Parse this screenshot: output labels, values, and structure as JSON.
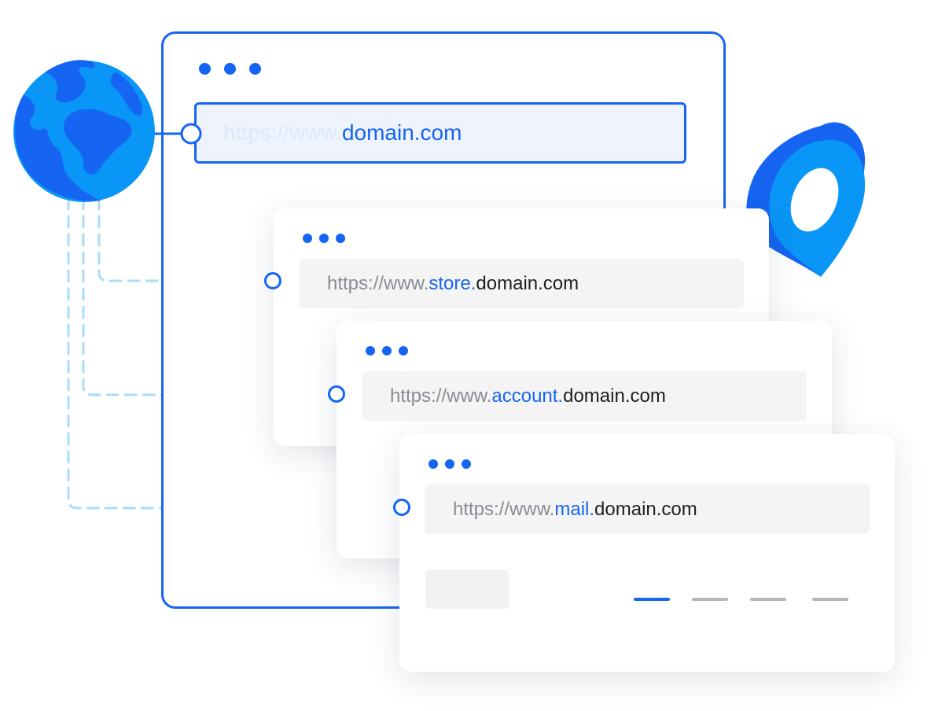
{
  "colors": {
    "accent": "#1565f2",
    "globe_light": "#0a96f6",
    "connector_dashed": "#a9dcfb",
    "pager_active": "#1565f2",
    "pager_inactive": "#b4b6bb"
  },
  "icons": {
    "globe": "globe-icon",
    "location": "location-pin-icon"
  },
  "main_window": {
    "url_prefix": "https://www.",
    "url_domain": "domain.com"
  },
  "windows": [
    {
      "url_prefix": "https://www.",
      "url_sub": "store.",
      "url_base": "domain.com"
    },
    {
      "url_prefix": "https://www.",
      "url_sub": "account.",
      "url_base": "domain.com"
    },
    {
      "url_prefix": "https://www.",
      "url_sub": "mail.",
      "url_base": "domain.com"
    }
  ],
  "pager": {
    "count": 4,
    "active_index": 0
  }
}
